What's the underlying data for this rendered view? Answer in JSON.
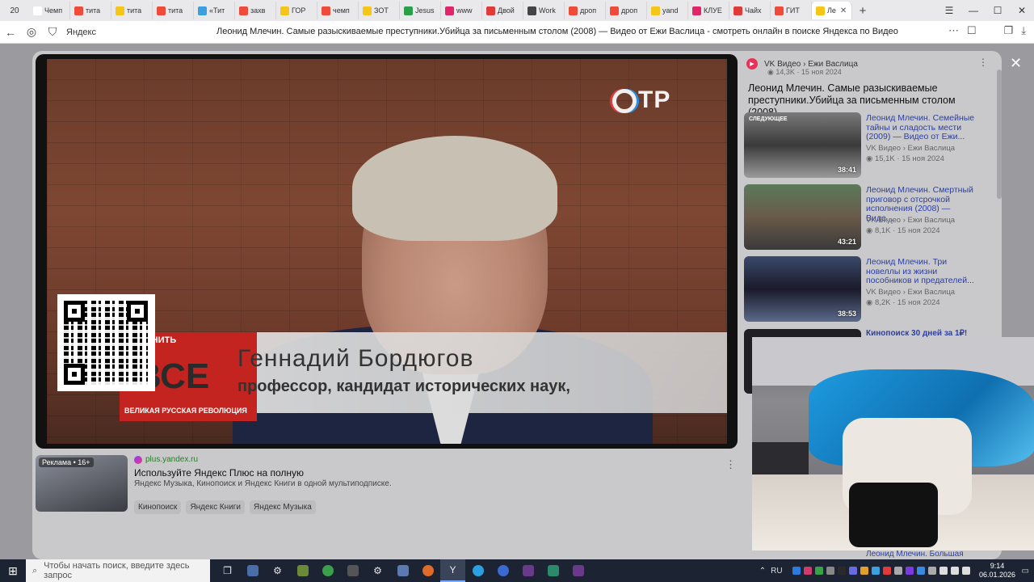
{
  "browser": {
    "tab_count": "20",
    "tabs": [
      {
        "label": "Чемп",
        "color": "#ffffff"
      },
      {
        "label": "тита",
        "color": "#f04a3a"
      },
      {
        "label": "тита",
        "color": "#f5c518"
      },
      {
        "label": "тита",
        "color": "#f04a3a"
      },
      {
        "label": "«Тит",
        "color": "#3aa0e0"
      },
      {
        "label": "захв",
        "color": "#f04a3a"
      },
      {
        "label": "ГОР",
        "color": "#f5c518"
      },
      {
        "label": "чемп",
        "color": "#f04a3a"
      },
      {
        "label": "ЗОТ",
        "color": "#f5c518"
      },
      {
        "label": "Jesus",
        "color": "#2aa04a"
      },
      {
        "label": "www",
        "color": "#e0256a"
      },
      {
        "label": "Двой",
        "color": "#e03a3a"
      },
      {
        "label": "Work",
        "color": "#444444"
      },
      {
        "label": "дроп",
        "color": "#f04a3a"
      },
      {
        "label": "дроп",
        "color": "#f04a3a"
      },
      {
        "label": "yand",
        "color": "#f5c518"
      },
      {
        "label": "КЛУЕ",
        "color": "#e0256a"
      },
      {
        "label": "Чайх",
        "color": "#e03a3a"
      },
      {
        "label": "ГИТ",
        "color": "#f04a3a"
      },
      {
        "label": "Ле",
        "color": "#f5c518"
      }
    ],
    "new_tab": "+",
    "site_name": "Яндекс",
    "page_title": "Леонид Млечин. Самые разыскиваемые преступники.Убийца за письменным столом (2008) — Видео от Ежи Васлица - смотреть онлайн в поиске Яндекса по Видео"
  },
  "video": {
    "channel_logo": "ТР",
    "lower_third_top": "ПОМНИТЬ",
    "lower_third_big": "ВСЕ",
    "lower_third_small": "ВЕЛИКАЯ РУССКАЯ РЕВОЛЮЦИЯ",
    "speaker_name": "Геннадий Бордюгов",
    "speaker_role": "профессор, кандидат исторических наук,"
  },
  "ad": {
    "badge": "Реклама • 16+",
    "domain": "plus.yandex.ru",
    "title": "Используйте Яндекс Плюс на полную",
    "description": "Яндекс Музыка, Кинопоиск и Яндекс Книги в одной мультиподписке.",
    "tags": [
      "Кинопоиск",
      "Яндекс Книги",
      "Яндекс Музыка"
    ]
  },
  "sidebar": {
    "source": "VK Видео › Ежи Васлица",
    "meta": "14,3K · 15 ноя 2024",
    "title": "Леонид Млечин. Самые разыскиваемые преступники.Убийца за письменным столом (2008)...",
    "related": [
      {
        "title": "Леонид Млечин. Семейные тайны и сладость мести (2009) — Видео от Ежи...",
        "source": "VK Видео › Ежи Васлица",
        "meta": "15,1K · 15 ноя 2024",
        "duration": "38:41",
        "next": "СЛЕДУЮЩЕЕ"
      },
      {
        "title": "Леонид Млечин. Смертный приговор с отсрочкой исполнения (2008) — Виде...",
        "source": "VK Видео › Ежи Васлица",
        "meta": "8,1K · 15 ноя 2024",
        "duration": "43:21",
        "next": ""
      },
      {
        "title": "Леонид Млечин. Три новеллы из жизни пособников и предателей...",
        "source": "VK Видео › Ежи Васлица",
        "meta": "8,2K · 15 ноя 2024",
        "duration": "38:53",
        "next": ""
      }
    ],
    "promo": "Кинопоиск 30 дней за 1₽!",
    "partial_bottom": "Леонид Млечин. Большая"
  },
  "taskbar": {
    "search_placeholder": "Чтобы начать поиск, введите здесь запрос",
    "lang": "RU",
    "time": "9:14",
    "date": "06.01.2026"
  }
}
